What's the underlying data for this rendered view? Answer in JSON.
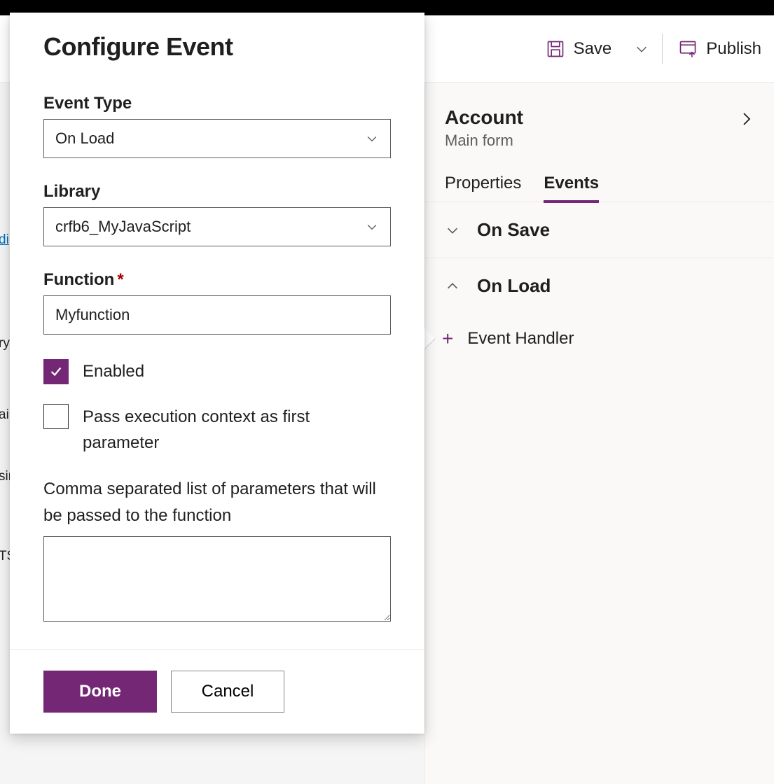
{
  "commandBar": {
    "save": "Save",
    "publish": "Publish"
  },
  "rightPanel": {
    "title": "Account",
    "subtitle": "Main form",
    "tabs": {
      "properties": "Properties",
      "events": "Events"
    },
    "sections": {
      "onSave": "On Save",
      "onLoad": "On Load"
    },
    "addHandler": "Event Handler"
  },
  "flyout": {
    "title": "Configure Event",
    "eventTypeLabel": "Event Type",
    "eventTypeValue": "On Load",
    "libraryLabel": "Library",
    "libraryValue": "crfb6_MyJavaScript",
    "functionLabel": "Function",
    "functionValue": "Myfunction",
    "enabledLabel": "Enabled",
    "passExecLabel": "Pass execution context as first parameter",
    "paramsLabel": "Comma separated list of parameters that will be passed to the function",
    "paramsValue": "",
    "done": "Done",
    "cancel": "Cancel"
  },
  "bgLeft": {
    "i0": "di",
    "i1": "ry",
    "i2": "ai",
    "i3": "sir",
    "i4": "TS"
  }
}
